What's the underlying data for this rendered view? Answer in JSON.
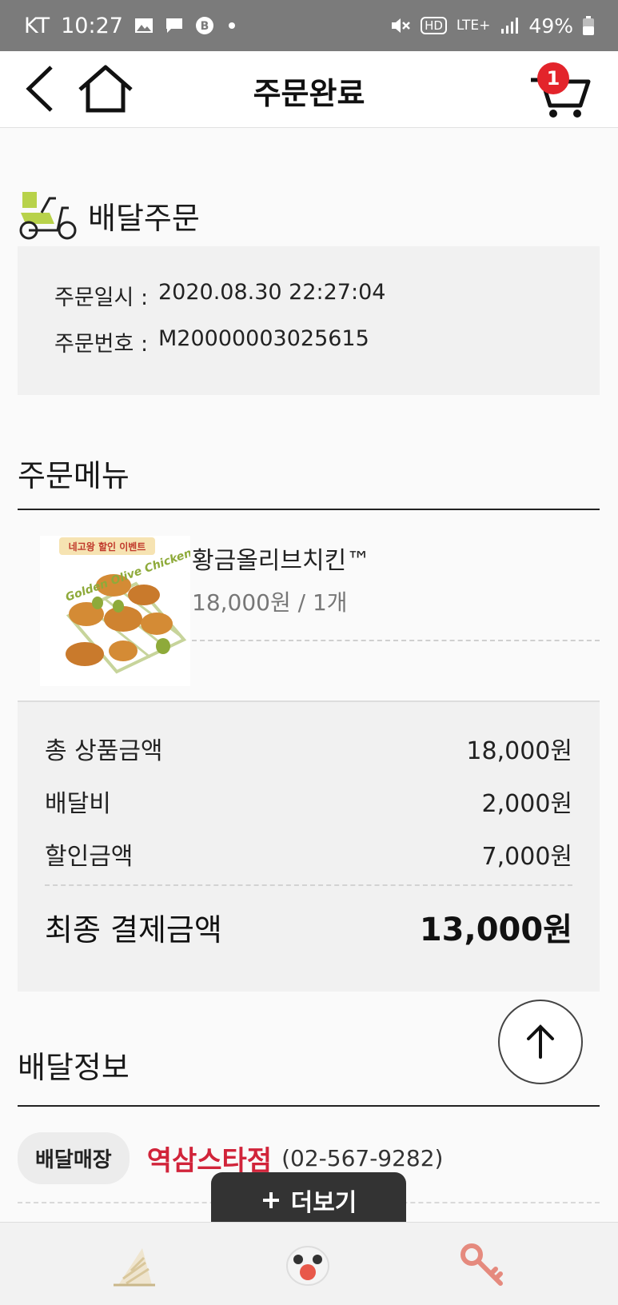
{
  "status_bar": {
    "carrier": "KT",
    "time": "10:27",
    "network": "LTE+",
    "hd": "HD",
    "battery": "49%"
  },
  "header": {
    "title": "주문완료",
    "cart_count": "1"
  },
  "delivery_order": {
    "heading": "배달주문",
    "order_date_label": "주문일시 :",
    "order_date": "2020.08.30 22:27:04",
    "order_number_label": "주문번호 :",
    "order_number": "M20000003025615"
  },
  "order_menu": {
    "heading": "주문메뉴",
    "item": {
      "image_banner": "네고왕 할인 이벤트",
      "image_text": "Golden Olive Chicken",
      "name": "황금올리브치킨™",
      "price_qty": "18,000원 / 1개"
    }
  },
  "price_summary": {
    "rows": [
      {
        "label": "총 상품금액",
        "value": "18,000원"
      },
      {
        "label": "배달비",
        "value": "2,000원"
      },
      {
        "label": "할인금액",
        "value": "7,000원"
      }
    ],
    "final_label": "최종 결제금액",
    "final_value": "13,000원"
  },
  "delivery_info": {
    "heading": "배달정보",
    "store_label": "배달매장",
    "store_name": "역삼스타점",
    "store_phone": "(02-567-9282)"
  },
  "more_button": {
    "label": "더보기"
  },
  "colors": {
    "accent_red": "#d1243a",
    "badge_red": "#e3242b",
    "status_bar": "#7b7b7b"
  },
  "icons": {
    "back": "chevron-left-icon",
    "home": "home-icon",
    "cart": "cart-icon",
    "scooter": "scooter-icon",
    "top": "arrow-up-icon",
    "plus": "plus-icon",
    "nav": [
      "ice-cream-icon",
      "mascot-icon",
      "key-icon"
    ]
  }
}
